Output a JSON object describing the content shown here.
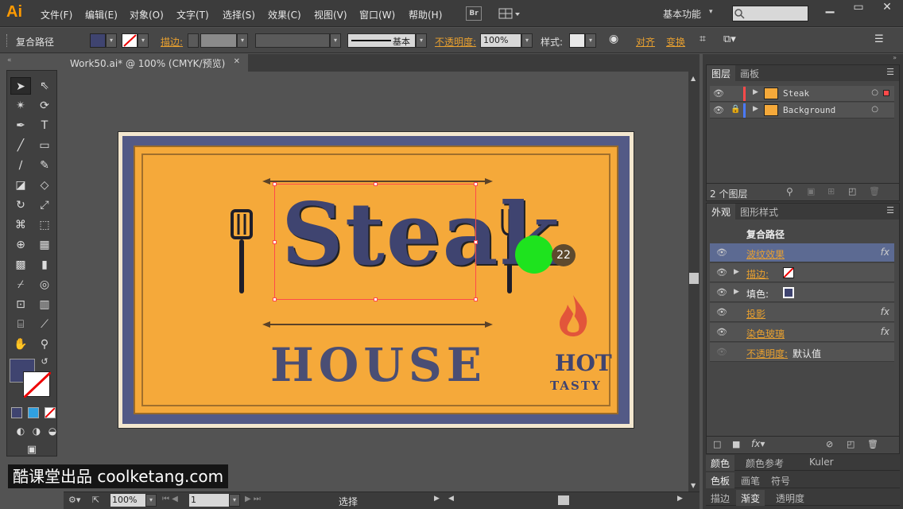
{
  "app": {
    "logo": "Ai"
  },
  "menu": [
    "文件(F)",
    "编辑(E)",
    "对象(O)",
    "文字(T)",
    "选择(S)",
    "效果(C)",
    "视图(V)",
    "窗口(W)",
    "帮助(H)"
  ],
  "bridge_label": "Br",
  "workspace": "基本功能",
  "control": {
    "object_type": "复合路径",
    "stroke_label": "描边:",
    "stroke_style": "基本",
    "opacity_label": "不透明度:",
    "opacity_value": "100%",
    "style_label": "样式:",
    "align_label": "对齐",
    "transform_label": "变换"
  },
  "document": {
    "tab_title": "Work50.ai* @ 100% (CMYK/预览)"
  },
  "artwork": {
    "title": "Steak",
    "subtitle": "HOUSE",
    "badge_top": "HOT",
    "badge_bottom": "TASTY"
  },
  "overlay": {
    "click_count": "22"
  },
  "status": {
    "zoom": "100%",
    "page": "1",
    "mode": "选择"
  },
  "layers_panel": {
    "tabs": [
      "图层",
      "画板"
    ],
    "layers": [
      {
        "name": "Steak",
        "color": "#ff4a4a"
      },
      {
        "name": "Background",
        "color": "#4a7aff"
      }
    ],
    "count_label": "2 个图层"
  },
  "appearance_panel": {
    "tabs": [
      "外观",
      "图形样式"
    ],
    "header": "复合路径",
    "rows": [
      {
        "label": "波纹效果",
        "fx": "fx"
      },
      {
        "label": "描边:"
      },
      {
        "label": "填色:"
      },
      {
        "label": "投影",
        "fx": "fx"
      },
      {
        "label": "染色玻璃",
        "fx": "fx"
      },
      {
        "label": "不透明度:",
        "value": "默认值"
      }
    ]
  },
  "mini_panels": [
    [
      "颜色",
      "颜色参考",
      "Kuler"
    ],
    [
      "色板",
      "画笔",
      "符号"
    ],
    [
      "描边",
      "渐变",
      "透明度"
    ]
  ],
  "watermark": "酷课堂出品 coolketang.com"
}
